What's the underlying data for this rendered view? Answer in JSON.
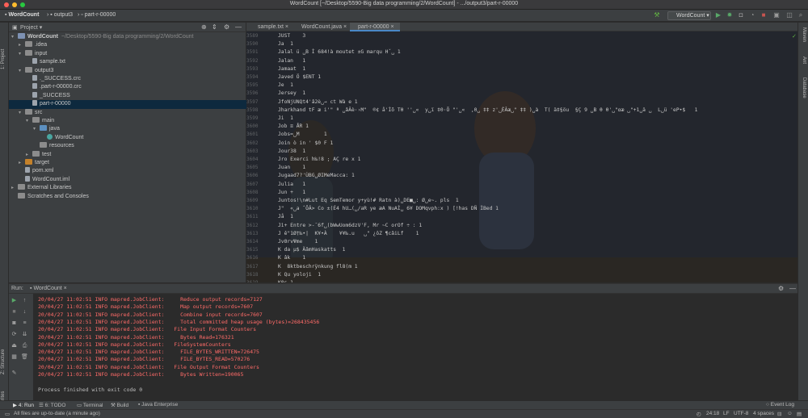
{
  "window": {
    "title": "WordCount [~/Desktop/5590-Big data programming/2/WordCount] - .../output3/part-r-00000"
  },
  "breadcrumb": [
    "WordCount",
    "output3",
    "part-r-00000"
  ],
  "toolbar": {
    "run_config": "WordCount"
  },
  "project_panel": {
    "title": "Project",
    "tree": [
      {
        "label": "WordCount",
        "path": "~/Desktop/5590-Big data programming/2/WordCount",
        "depth": 0,
        "arrow": "▾",
        "icon": "module"
      },
      {
        "label": ".idea",
        "depth": 1,
        "arrow": "▸",
        "icon": "folder"
      },
      {
        "label": "input",
        "depth": 1,
        "arrow": "▾",
        "icon": "folder"
      },
      {
        "label": "sample.txt",
        "depth": 2,
        "arrow": "",
        "icon": "file"
      },
      {
        "label": "output3",
        "depth": 1,
        "arrow": "▾",
        "icon": "folder"
      },
      {
        "label": "._SUCCESS.crc",
        "depth": 2,
        "arrow": "",
        "icon": "file"
      },
      {
        "label": ".part-r-00000.crc",
        "depth": 2,
        "arrow": "",
        "icon": "file"
      },
      {
        "label": "_SUCCESS",
        "depth": 2,
        "arrow": "",
        "icon": "file"
      },
      {
        "label": "part-r-00000",
        "depth": 2,
        "arrow": "",
        "icon": "file",
        "selected": true
      },
      {
        "label": "src",
        "depth": 1,
        "arrow": "▾",
        "icon": "folder"
      },
      {
        "label": "main",
        "depth": 2,
        "arrow": "▾",
        "icon": "folder"
      },
      {
        "label": "java",
        "depth": 3,
        "arrow": "▾",
        "icon": "src"
      },
      {
        "label": "WordCount",
        "depth": 4,
        "arrow": "",
        "icon": "java"
      },
      {
        "label": "resources",
        "depth": 3,
        "arrow": "",
        "icon": "folder"
      },
      {
        "label": "test",
        "depth": 2,
        "arrow": "▸",
        "icon": "folder"
      },
      {
        "label": "target",
        "depth": 1,
        "arrow": "▸",
        "icon": "orange"
      },
      {
        "label": "pom.xml",
        "depth": 1,
        "arrow": "",
        "icon": "file"
      },
      {
        "label": "WordCount.iml",
        "depth": 1,
        "arrow": "",
        "icon": "file"
      },
      {
        "label": "External Libraries",
        "depth": 0,
        "arrow": "▸",
        "icon": "folder"
      },
      {
        "label": "Scratches and Consoles",
        "depth": 0,
        "arrow": "",
        "icon": "folder"
      }
    ]
  },
  "editor": {
    "tabs": [
      {
        "label": "sample.txt",
        "active": false
      },
      {
        "label": "WordCount.java",
        "active": false
      },
      {
        "label": "part-r-00000",
        "active": true
      }
    ],
    "lines": [
      {
        "n": "3589",
        "text": "JUST    3"
      },
      {
        "n": "3590",
        "text": "Ja  1"
      },
      {
        "n": "3591",
        "text": "Jalal ü ␣B Ì 684!à moutet ±G marqu Hˇ␣ 1"
      },
      {
        "n": "3592",
        "text": "Jalan   1"
      },
      {
        "n": "3593",
        "text": "Jamaat  1"
      },
      {
        "n": "3594",
        "text": "Javed Ö $ENT 1"
      },
      {
        "n": "3595",
        "text": "Je  1"
      },
      {
        "n": "3596",
        "text": "Jersey  1"
      },
      {
        "n": "3597",
        "text": "JfoNjUNQt4'â2è␣→ ct Wà e 1"
      },
      {
        "n": "3598",
        "text": "Jharkhand tF æ i'\" ª ␣âÂè·›M\"  ®¢ å'Ìõ Tθ ''␣«  y␣ï ‡0·Õ \"'␣«  ,0␣ ‡‡ z'␣ÈÂæ␣\" ‡‡ )␣à  T( ä‡§öu  §Ç 9 ␣B θ θ'␣\"αæ ␣\"+1␣ä ␣  L␣ü 'eP•$   1"
      },
      {
        "n": "3599",
        "text": "Ji  1"
      },
      {
        "n": "3600",
        "text": "Job ≡ ÅR 1"
      },
      {
        "n": "3601",
        "text": "Jobs=␣M        1"
      },
      {
        "n": "3602",
        "text": "Join ò in ' $0 F 1"
      },
      {
        "n": "3603",
        "text": "Jour38  1"
      },
      {
        "n": "3604",
        "text": "Jro Exerci h‰!8 ; AÇ re x 1"
      },
      {
        "n": "3605",
        "text": "Juan    1"
      },
      {
        "n": "3606",
        "text": "Jugaad7?'ÙBG␣ØIMeMacca: 1"
      },
      {
        "n": "3607",
        "text": "Julia   1"
      },
      {
        "n": "3608",
        "text": "Jun +   1"
      },
      {
        "n": "3609",
        "text": "Juntos!\\n#Lut Eq SemTemor y+yù!# Ratn à)␣DE■␣: Ø␣e~. pls  1"
      },
      {
        "n": "3610",
        "text": "J\"  «␣a ˆÕÂ> Co ±(É4 hU…(␣/aR ye æA NuAÌ␣ 6¥ DOMqvph:x ) [!has DÑ ÌBed 1"
      },
      {
        "n": "3611",
        "text": "Jå  1"
      },
      {
        "n": "3612",
        "text": "Jì+ Entre >-¯6f␣(bWwUom6dzV'F, Mr ~C orOf ÷ : 1"
      },
      {
        "n": "3613",
        "text": "J ê\"1Ø†‰•|  K¥•À    ¥¥‰.u   ␣\" ¿ôZ ¶câiLf    1"
      },
      {
        "n": "3614",
        "text": "JvΘrvΨme    1"
      },
      {
        "n": "3615",
        "text": "K da µ$ ÄâmHaskatts  1"
      },
      {
        "n": "3616",
        "text": "K âk    1"
      },
      {
        "n": "3617",
        "text": "K  8ktbeschrÿnkung fl8(m 1"
      },
      {
        "n": "3618",
        "text": "K Qu yoloji  1"
      },
      {
        "n": "3619",
        "text": "K0s 1"
      },
      {
        "n": "3620",
        "text": "K1BeKB7Zxy'SB- @pradiprsagar:    1"
      },
      {
        "n": "3621",
        "text": "KAR=ÙI  1"
      }
    ]
  },
  "run_panel": {
    "label": "Run:",
    "tab": "WordCount",
    "logs": [
      {
        "text": "20/04/27 11:02:51 INFO mapred.JobClient:     Reduce output records=7127",
        "type": "error"
      },
      {
        "text": "20/04/27 11:02:51 INFO mapred.JobClient:     Map output records=7607",
        "type": "error"
      },
      {
        "text": "20/04/27 11:02:51 INFO mapred.JobClient:     Combine input records=7607",
        "type": "error"
      },
      {
        "text": "20/04/27 11:02:51 INFO mapred.JobClient:     Total committed heap usage (bytes)=268435456",
        "type": "error"
      },
      {
        "text": "20/04/27 11:02:51 INFO mapred.JobClient:   File Input Format Counters",
        "type": "error"
      },
      {
        "text": "20/04/27 11:02:51 INFO mapred.JobClient:     Bytes Read=176321",
        "type": "error"
      },
      {
        "text": "20/04/27 11:02:51 INFO mapred.JobClient:   FileSystemCounters",
        "type": "error"
      },
      {
        "text": "20/04/27 11:02:51 INFO mapred.JobClient:     FILE_BYTES_WRITTEN=726475",
        "type": "error"
      },
      {
        "text": "20/04/27 11:02:51 INFO mapred.JobClient:     FILE_BYTES_READ=570276",
        "type": "error"
      },
      {
        "text": "20/04/27 11:02:51 INFO mapred.JobClient:   File Output Format Counters",
        "type": "error"
      },
      {
        "text": "20/04/27 11:02:51 INFO mapred.JobClient:     Bytes Written=190065",
        "type": "error"
      },
      {
        "text": "",
        "type": "normal"
      },
      {
        "text": "Process finished with exit code 0",
        "type": "normal"
      }
    ]
  },
  "bottom_tools": {
    "run": "4: Run",
    "todo": "6: TODO",
    "terminal": "Terminal",
    "build": "Build",
    "java_enterprise": "Java Enterprise",
    "event_log": "Event Log"
  },
  "status": {
    "message": "All files are up-to-date (a minute ago)",
    "position": "24:18",
    "line_sep": "LF",
    "encoding": "UTF-8",
    "indent": "4 spaces"
  },
  "side_labels": {
    "left_project": "1: Project",
    "left_structure": "Z: Structure",
    "left_favorites": "2: Favorites",
    "right_maven": "Maven",
    "right_ant": "Ant",
    "right_database": "Database"
  },
  "colors": {
    "accent": "#4a88c7",
    "error_text": "#ff6b68",
    "selection": "#0d293e"
  }
}
